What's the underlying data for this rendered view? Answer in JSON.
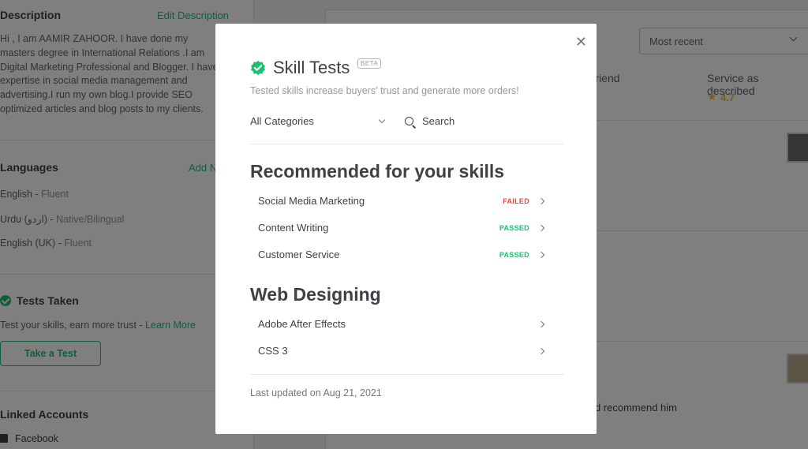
{
  "background": {
    "description": {
      "heading": "Description",
      "edit_link": "Edit Description",
      "text": "Hi , I am AAMIR ZAHOOR. I have done my\nmasters degree in International Relations .I am\nDigital Marketing Professional and Blogger. I have\nexpertise in social media management and\nadvertising.I run my own blog.I provide SEO\noptimized articles and blog posts to my clients."
    },
    "languages": {
      "heading": "Languages",
      "add_link": "Add New",
      "items": [
        {
          "name": "English",
          "level": "Fluent"
        },
        {
          "name": "Urdu (اردو)",
          "level": "Native/Bilingual"
        },
        {
          "name": "English (UK)",
          "level": "Fluent"
        }
      ]
    },
    "tests_taken": {
      "heading": "Tests Taken",
      "prompt": "Test your skills, earn more trust - ",
      "learn_more": "Learn More",
      "button": "Take a Test"
    },
    "linked_accounts": {
      "heading": "Linked Accounts",
      "facebook": "Facebook"
    },
    "reviews": {
      "sort_value": "Most recent",
      "recommend_label": "Recommend to a friend",
      "service_label": "Service as described",
      "service_rating": "4.7",
      "review_snippet": "I would recommend him"
    }
  },
  "modal": {
    "title": "Skill Tests",
    "badge": "BETA",
    "subtitle": "Tested skills increase buyers' trust and generate more orders!",
    "category_select": "All Categories",
    "search_placeholder": "Search",
    "groups": [
      {
        "title": "Recommended for your skills",
        "items": [
          {
            "name": "Social Media Marketing",
            "status": "FAILED"
          },
          {
            "name": "Content Writing",
            "status": "PASSED"
          },
          {
            "name": "Customer Service",
            "status": "PASSED"
          }
        ]
      },
      {
        "title": "Web Designing",
        "items": [
          {
            "name": "Adobe After Effects",
            "status": ""
          },
          {
            "name": "CSS 3",
            "status": ""
          }
        ]
      }
    ],
    "last_updated": "Last updated on Aug 21, 2021"
  },
  "colors": {
    "brand_green": "#1dbf73",
    "failed_red": "#e4473d",
    "rating_star": "#ffb33e"
  },
  "icons": [
    "verified-check-icon",
    "close-icon",
    "chevron-down-icon",
    "search-icon",
    "chevron-right-icon",
    "star-icon",
    "facebook-icon"
  ]
}
